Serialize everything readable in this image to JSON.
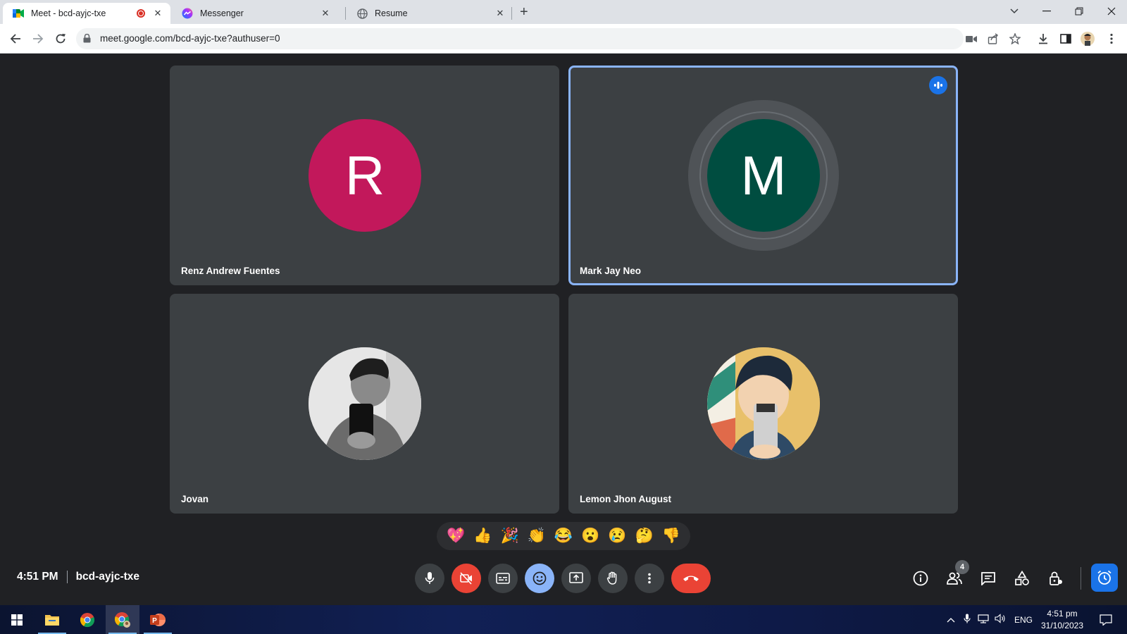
{
  "browser": {
    "tabs": [
      {
        "title": "Meet - bcd-ayjc-txe",
        "icon": "google-meet-icon",
        "recording": true
      },
      {
        "title": "Messenger",
        "icon": "messenger-icon"
      },
      {
        "title": "Resume",
        "icon": "globe-icon"
      }
    ],
    "url": "meet.google.com/bcd-ayjc-txe?authuser=0"
  },
  "participants": [
    {
      "name": "Renz Andrew Fuentes",
      "initial": "R",
      "avatar_color": "#c2185b"
    },
    {
      "name": "Mark Jay Neo",
      "initial": "M",
      "avatar_color": "#004d40",
      "speaking": true
    },
    {
      "name": "Jovan",
      "avatar": "photo"
    },
    {
      "name": "Lemon Jhon August",
      "avatar": "photo"
    }
  ],
  "reactions": [
    "💖",
    "👍",
    "🎉",
    "👏",
    "😂",
    "😮",
    "😢",
    "🤔",
    "👎"
  ],
  "meeting": {
    "time": "4:51 PM",
    "code": "bcd-ayjc-txe",
    "participant_count": "4"
  },
  "taskbar": {
    "language": "ENG",
    "time": "4:51 pm",
    "date": "31/10/2023"
  },
  "colors": {
    "accent": "#1a73e8",
    "danger": "#ea4335",
    "tile_bg": "#3c4043",
    "page_bg": "#202124"
  }
}
